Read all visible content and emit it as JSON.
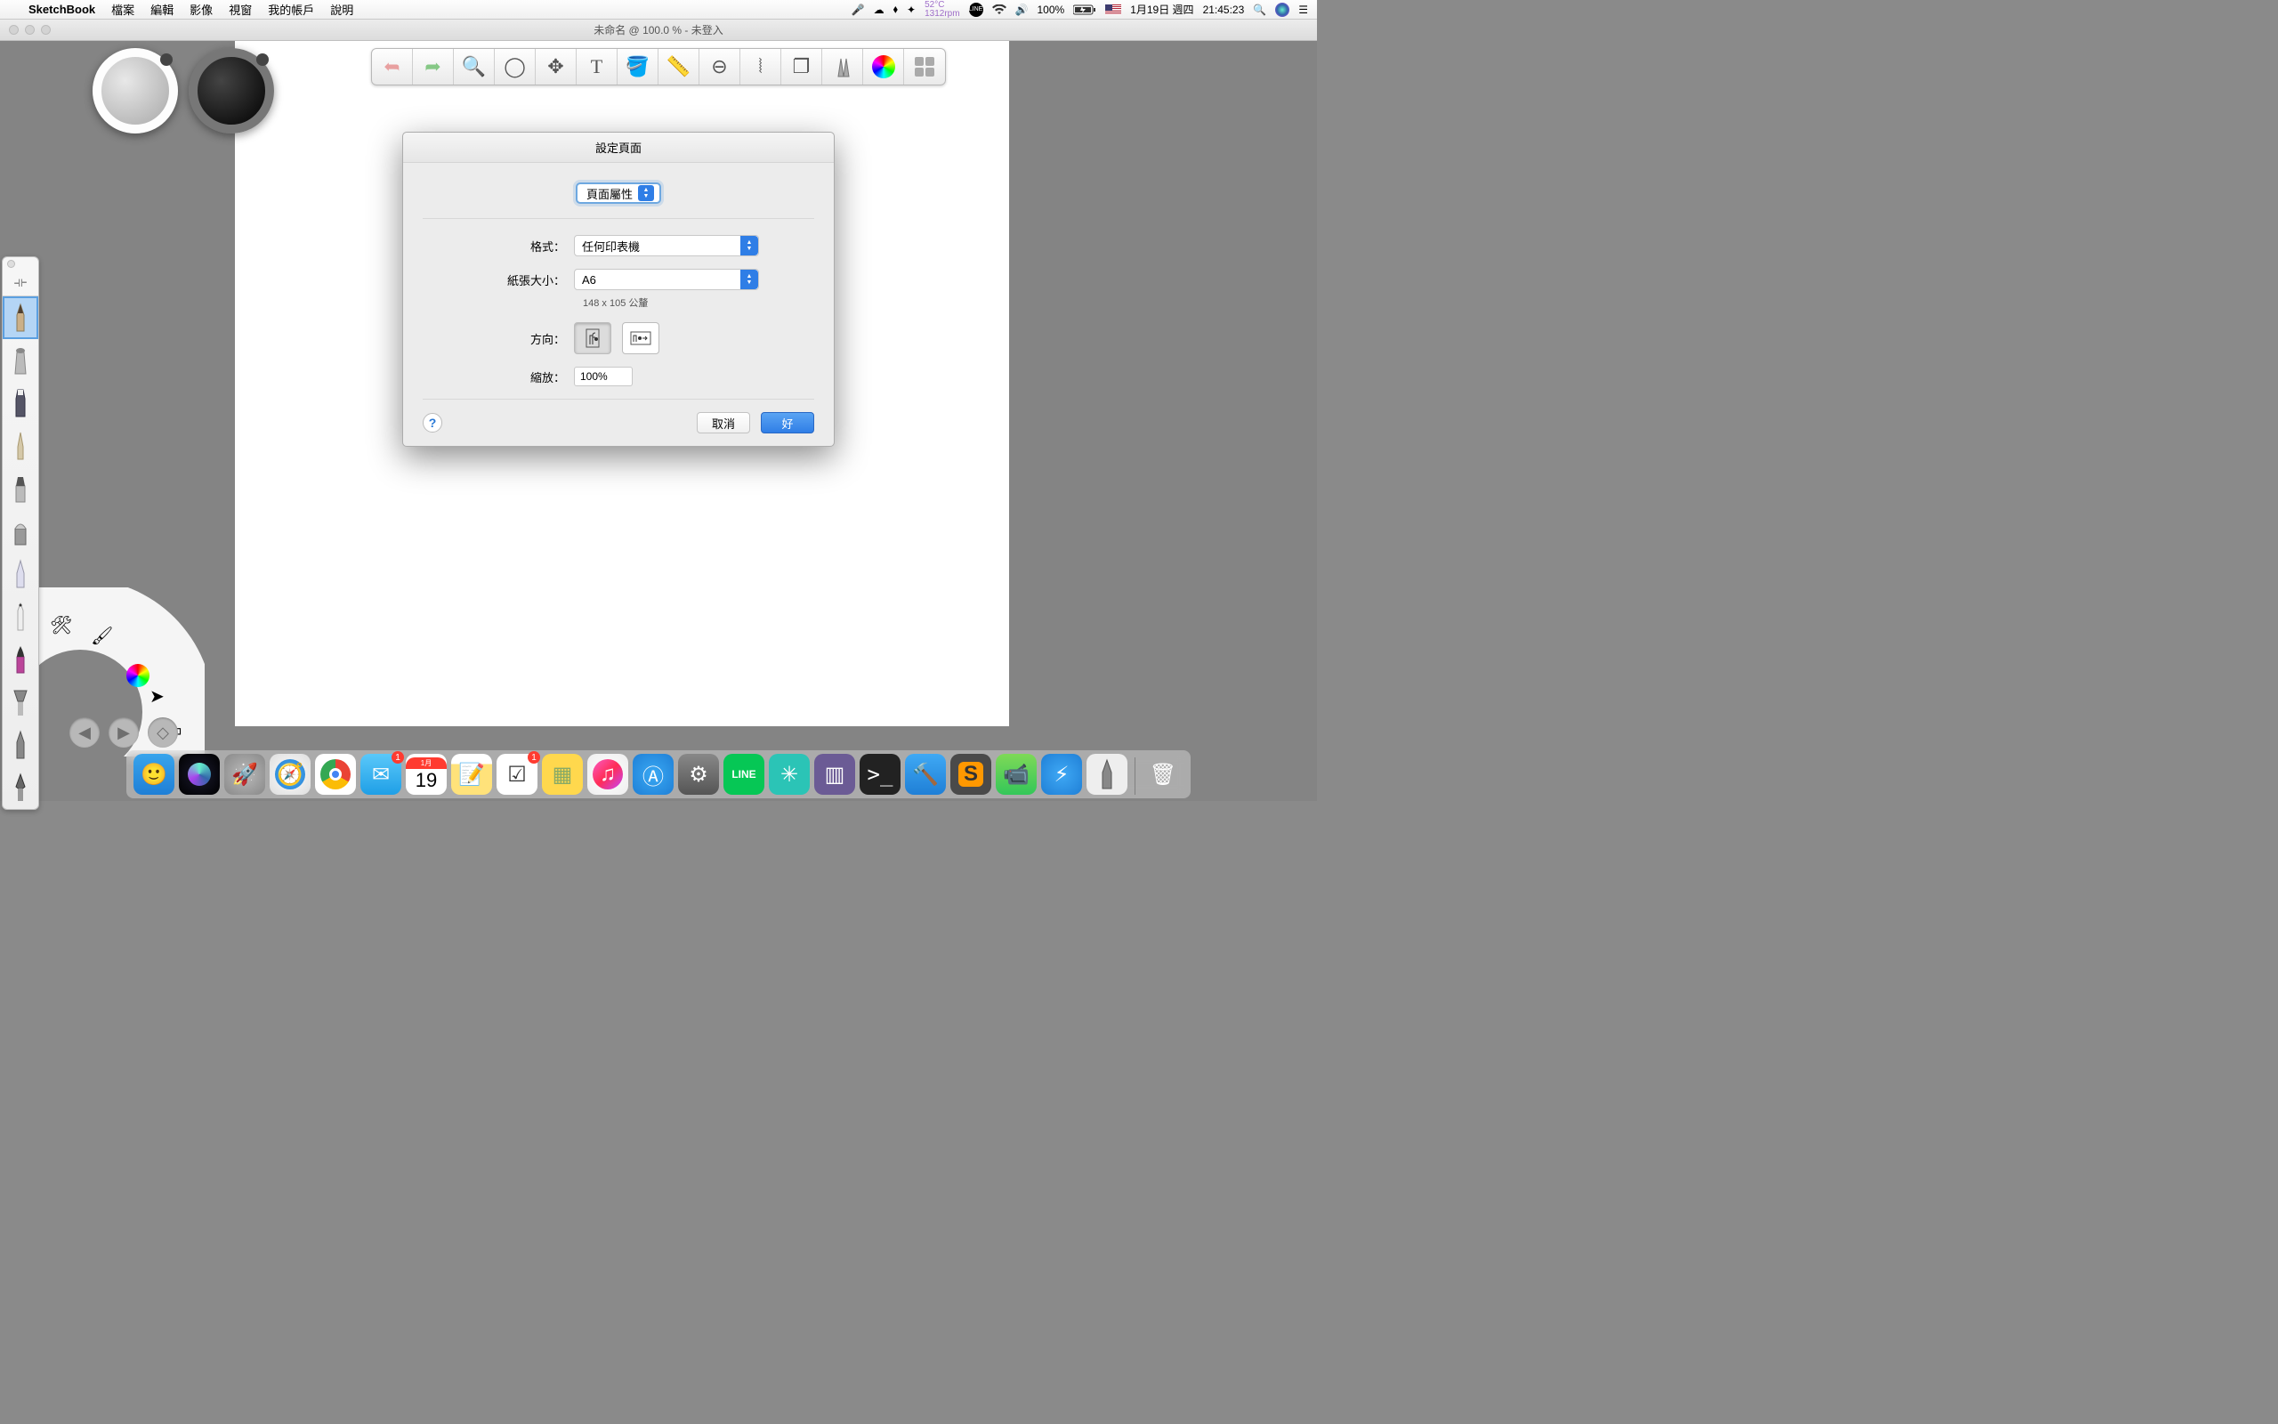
{
  "menubar": {
    "app_name": "SketchBook",
    "items": [
      "檔案",
      "編輯",
      "影像",
      "視窗",
      "我的帳戶",
      "說明"
    ],
    "right": {
      "temp": "52°C",
      "rpm": "1312rpm",
      "battery": "100%",
      "date": "1月19日 週四",
      "time": "21:45:23"
    }
  },
  "window": {
    "title": "未命名 @ 100.0 % - 未登入"
  },
  "dialog": {
    "title": "設定頁面",
    "top_select": "頁面屬性",
    "format_label": "格式：",
    "format_value": "任何印表機",
    "paper_label": "紙張大小：",
    "paper_value": "A6",
    "paper_hint": "148 x 105 公釐",
    "orient_label": "方向：",
    "scale_label": "縮放：",
    "scale_value": "100%",
    "cancel": "取消",
    "ok": "好",
    "help": "?"
  },
  "dock": {
    "cal_month": "1月",
    "cal_day": "19",
    "mail_badge": "1",
    "reminders_badge": "1"
  }
}
